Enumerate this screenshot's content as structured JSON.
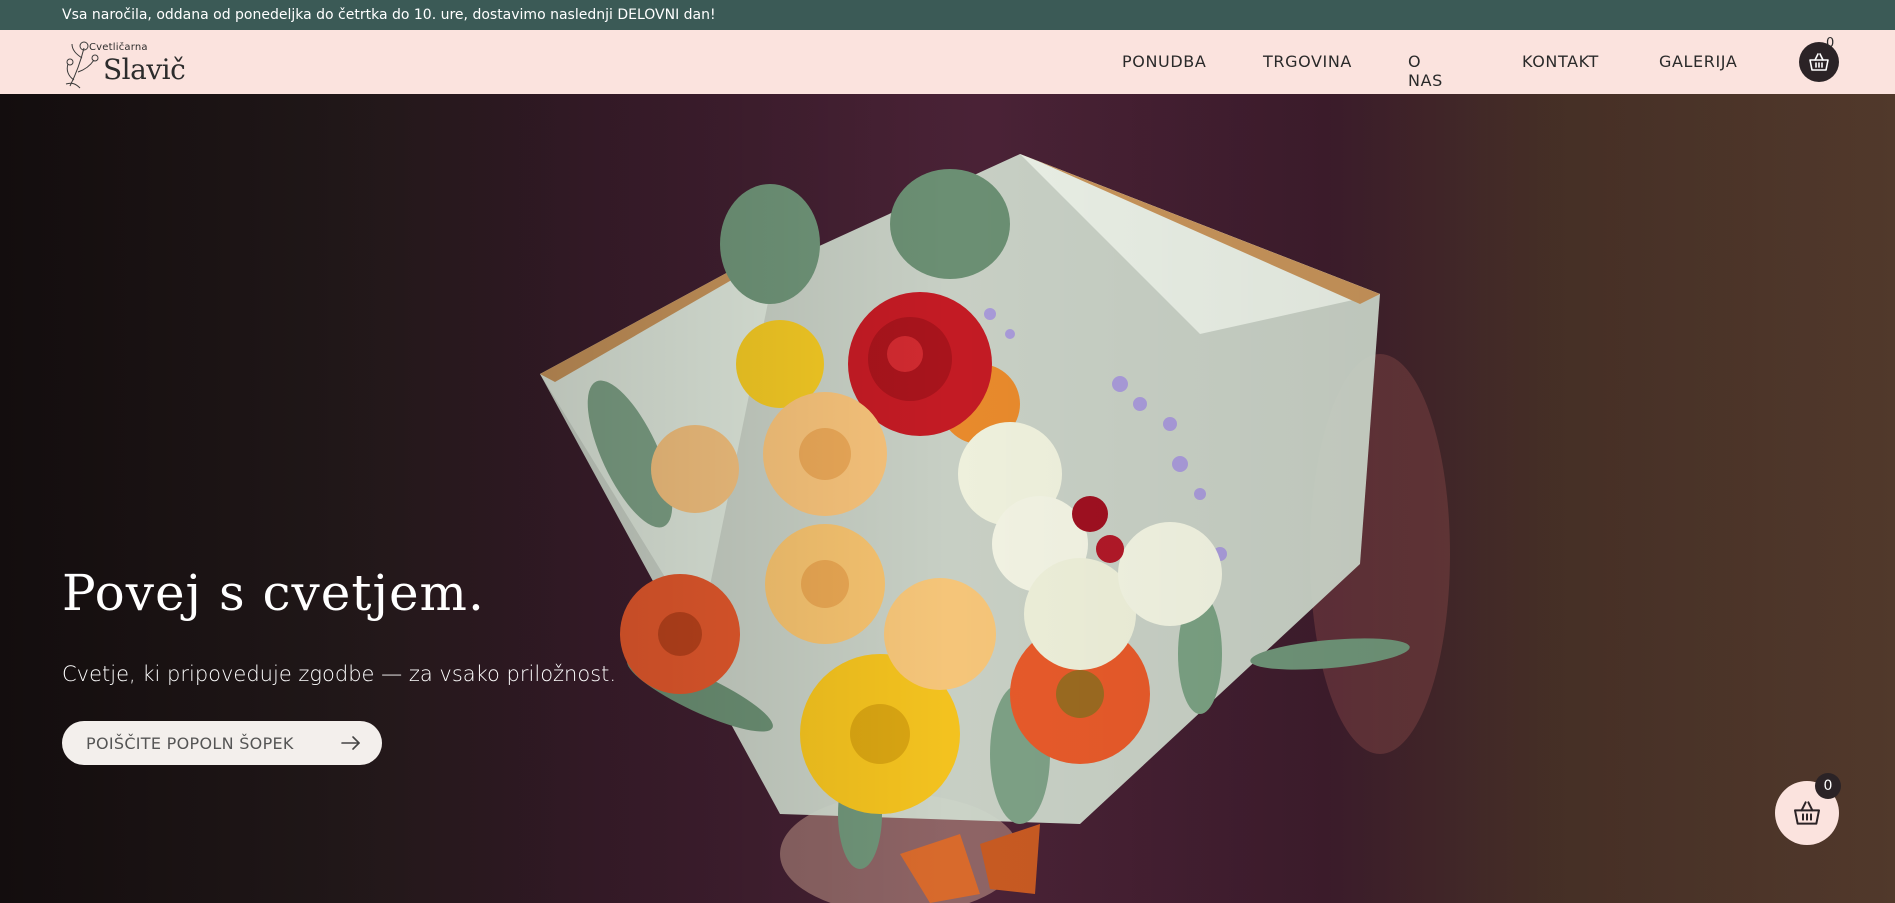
{
  "announcement": "Vsa naročila, oddana od ponedeljka do četrtka do 10. ure, dostavimo naslednji DELOVNI dan!",
  "logo": {
    "small": "Cvetličarna",
    "main": "Slavič"
  },
  "nav": {
    "items": [
      "PONUDBA",
      "TRGOVINA",
      "O NAS",
      "KONTAKT",
      "GALERIJA"
    ]
  },
  "cart": {
    "count": "0",
    "icon": "basket-icon"
  },
  "hero": {
    "title": "Povej s cvetjem.",
    "subtitle": "Cvetje, ki pripoveduje zgodbe — za vsako priložnost.",
    "button_label": "POIŠČITE POPOLN ŠOPEK",
    "button_icon": "arrow-right-icon"
  },
  "floating_cart": {
    "count": "0",
    "icon": "basket-icon"
  },
  "colors": {
    "topbar": "#3b5a56",
    "header": "#fbe3de",
    "cart": "#2b2326"
  }
}
